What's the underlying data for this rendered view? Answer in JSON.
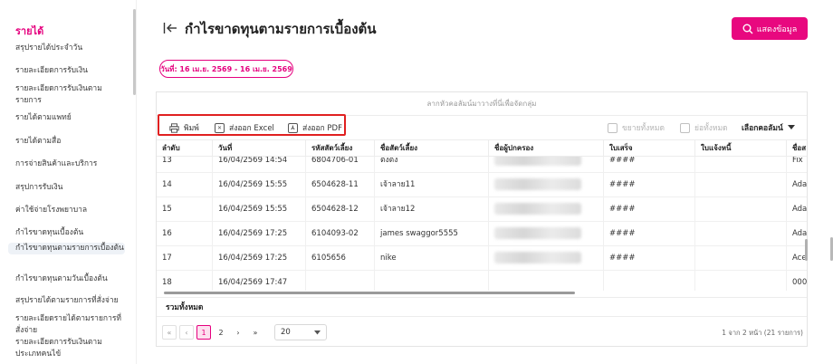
{
  "sidebar": {
    "heading": "รายได้",
    "items": [
      {
        "label": "สรุปรายได้ประจำวัน"
      },
      {
        "label": "รายละเอียดการรับเงิน"
      },
      {
        "label": "รายละเอียดการรับเงินตามรายการ"
      },
      {
        "label": "รายได้ตามแพทย์"
      },
      {
        "label": "รายได้ตามสื่อ"
      },
      {
        "label": "การจ่ายสินค้าและบริการ"
      },
      {
        "label": "สรุปการรับเงิน"
      },
      {
        "label": "ค่าใช้จ่ายโรงพยาบาล"
      },
      {
        "label": "กำไรขาดทุนเบื้องต้น"
      },
      {
        "label": "กำไรขาดทุนตามรายการเบื้องต้น"
      },
      {
        "label": "กำไรขาดทุนตามวันเบื้องต้น"
      },
      {
        "label": "สรุปรายได้ตามรายการที่สั่งจ่าย"
      },
      {
        "label": "รายละเอียดรายได้ตามรายการที่สั่งจ่าย"
      },
      {
        "label": "รายละเอียดการรับเงินตามประเภทคนไข้"
      }
    ]
  },
  "header": {
    "title": "กำไรขาดทุนตามรายการเบื้องต้น",
    "show_button": "แสดงข้อมูล"
  },
  "filter": {
    "date_range": "วันที่: 16 เม.ย. 2569 - 16 เม.ย. 2569"
  },
  "grid": {
    "group_hint": "ลากหัวคอลัมน์มาวางที่นี่เพื่อจัดกลุ่ม",
    "toolbar": {
      "print": "พิมพ์",
      "export_excel": "ส่งออก Excel",
      "export_pdf": "ส่งออก PDF",
      "expand_all": "ขยายทั้งหมด",
      "collapse_all": "ย่อทั้งหมด",
      "choose_columns": "เลือกคอลัมน์"
    },
    "columns": [
      "ลำดับ",
      "วันที่",
      "รหัสสัตว์เลี้ยง",
      "ชื่อสัตว์เลี้ยง",
      "ชื่อผู้ปกครอง",
      "ใบเสร็จ",
      "ใบแจ้งหนี้",
      "ชื่อส"
    ],
    "rows": [
      {
        "no": "13",
        "date": "16/04/2569 14:54",
        "code": "6804706-01",
        "pet": "ตงตง",
        "owner": "",
        "receipt": "####",
        "invoice": "",
        "extra": "Fix"
      },
      {
        "no": "14",
        "date": "16/04/2569 15:55",
        "code": "6504628-11",
        "pet": "เจ้าลาย11",
        "owner": "",
        "receipt": "####",
        "invoice": "",
        "extra": "Ada"
      },
      {
        "no": "15",
        "date": "16/04/2569 15:55",
        "code": "6504628-12",
        "pet": "เจ้าลาย12",
        "owner": "",
        "receipt": "####",
        "invoice": "",
        "extra": "Ada"
      },
      {
        "no": "16",
        "date": "16/04/2569 17:25",
        "code": "6104093-02",
        "pet": "james swaggor5555",
        "owner": "",
        "receipt": "####",
        "invoice": "",
        "extra": "Ada"
      },
      {
        "no": "17",
        "date": "16/04/2569 17:25",
        "code": "6105656",
        "pet": "nike",
        "owner": "",
        "receipt": "####",
        "invoice": "",
        "extra": "Ace"
      },
      {
        "no": "18",
        "date": "16/04/2569 17:47",
        "code": "",
        "pet": "",
        "owner": "",
        "receipt": "",
        "invoice": "",
        "extra": "000"
      }
    ],
    "total_label": "รวมทั้งหมด",
    "pager": {
      "first": "«",
      "prev": "‹",
      "pages": [
        "1",
        "2"
      ],
      "current": "1",
      "next": "›",
      "last": "»",
      "page_size": "20",
      "info": "1 จาก 2 หน้า (21 รายการ)"
    }
  },
  "colors": {
    "accent": "#e5007e",
    "highlight": "#e02020"
  }
}
